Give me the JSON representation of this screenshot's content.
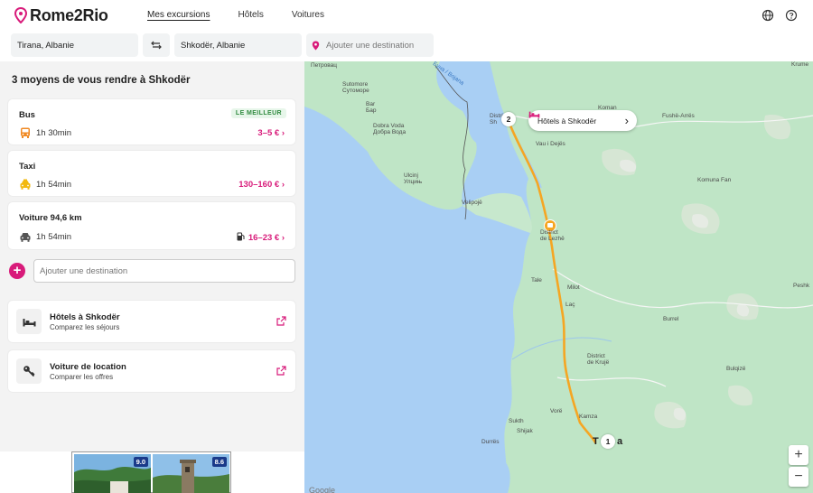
{
  "header": {
    "brand": "Rome2Rio",
    "nav": [
      "Mes excursions",
      "Hôtels",
      "Voitures"
    ],
    "icons": [
      "globe-icon",
      "help-icon"
    ]
  },
  "search": {
    "origin": "Tirana, Albanie",
    "destination": "Shkodër, Albanie",
    "add_destination_placeholder": "Ajouter une destination"
  },
  "panel": {
    "title": "3 moyens de vous rendre à Shkodër",
    "routes": [
      {
        "mode": "Bus",
        "duration": "1h 30min",
        "price": "3–5 €",
        "badge": "LE MEILLEUR",
        "icon": "bus-icon"
      },
      {
        "mode": "Taxi",
        "duration": "1h 54min",
        "price": "130–160 €",
        "icon": "taxi-icon"
      },
      {
        "mode": "Voiture 94,6 km",
        "duration": "1h 54min",
        "price": "16–23 €",
        "icon": "car-icon"
      }
    ],
    "add_destination_placeholder": "Ajouter une destination",
    "promos": [
      {
        "title": "Hôtels à Shkodër",
        "subtitle": "Comparez les séjours",
        "icon": "bed-icon"
      },
      {
        "title": "Voiture de location",
        "subtitle": "Comparer les offres",
        "icon": "key-icon"
      }
    ],
    "hotel_scores": [
      "9.0",
      "8.6"
    ]
  },
  "map": {
    "hotel_pill": "Hôtels à Shkodër",
    "stop_start": "1",
    "stop_end": "2",
    "start_city_letters": "T",
    "start_city_suffix": "a",
    "attribution": "Google",
    "zoom_in": "+",
    "zoom_out": "−",
    "labels": {
      "petrovac": "Петровац",
      "sutomore1": "Sutomore",
      "sutomore2": "Сутоморе",
      "bar1": "Bar",
      "bar2": "Бар",
      "dobra1": "Dobra Voda",
      "dobra2": "Добра Вода",
      "ulcinj1": "Ulcinj",
      "ulcinj2": "Улцињ",
      "velipoje": "Velipojë",
      "district_sh1": "District",
      "district_sh2": "Sh",
      "koman": "Koman",
      "fushe": "Fushë-Arrës",
      "vau": "Vau i Dejës",
      "komuna": "Komuna Fan",
      "krume": "Krume",
      "lezhe1": "District",
      "lezhe2": "de Lezhë",
      "tale": "Tale",
      "milot": "Milot",
      "lac": "Laç",
      "burrel": "Burrel",
      "peshk": "Peshk",
      "kruje1": "District",
      "kruje2": "de Krujë",
      "bulqize": "Bulqizë",
      "vore": "Vorë",
      "kamza": "Kamza",
      "sukth": "Sukth",
      "shijak": "Shijak",
      "durres": "Durrës",
      "river": "Буна / Bojana"
    }
  },
  "colors": {
    "accent": "#d81b7a",
    "route": "#f5a623",
    "water": "#a9cff4",
    "land": "#bfe5c6"
  }
}
